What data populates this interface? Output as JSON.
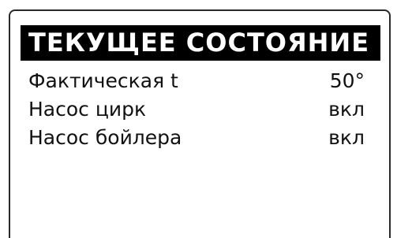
{
  "screen": {
    "title": "ТЕКУЩЕЕ СОСТОЯНИЕ",
    "rows": [
      {
        "label": "Фактическая t",
        "value": "50°"
      },
      {
        "label": "Насос цирк",
        "value": "вкл"
      },
      {
        "label": "Насос бойлера",
        "value": "вкл"
      }
    ]
  }
}
